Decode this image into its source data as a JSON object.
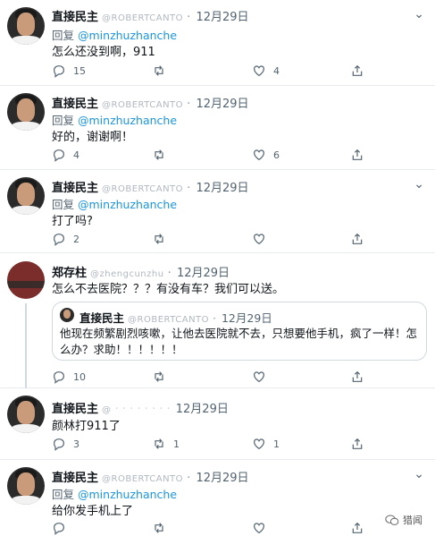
{
  "tweets": [
    {
      "name": "直接民主",
      "handle": "@ROBERTCANTO",
      "date": "12月29日",
      "reply_prefix": "回复",
      "reply_to": "@minzhuzhanche",
      "text": "怎么还没到啊，911",
      "replies": "15",
      "retweets": "",
      "likes": "4"
    },
    {
      "name": "直接民主",
      "handle": "@ROBERTCANTO",
      "date": "12月29日",
      "reply_prefix": "回复",
      "reply_to": "@minzhuzhanche",
      "text": "好的，谢谢啊！",
      "replies": "4",
      "retweets": "",
      "likes": "6"
    },
    {
      "name": "直接民主",
      "handle": "@ROBERTCANTO",
      "date": "12月29日",
      "text": "打了吗?",
      "replies": "2",
      "retweets": "",
      "likes": ""
    },
    {
      "name": "郑存柱",
      "handle": "@zhengcunzhu",
      "date": "12月29日",
      "text": "怎么不去医院？？？有没有车？我们可以送。",
      "quote": {
        "name": "直接民主",
        "handle": "@ROBERTCANTO",
        "date": "12月29日",
        "text": "他现在频繁剧烈咳嗽，让他去医院就不去，只想要他手机，疯了一样！怎么办？求助！！！！！！"
      },
      "replies": "10",
      "retweets": "",
      "likes": ""
    },
    {
      "name": "直接民主",
      "handle": "@",
      "date": "12月29日",
      "text": "颜林打911了",
      "replies": "3",
      "retweets": "1",
      "likes": "1"
    },
    {
      "name": "直接民主",
      "handle": "@ROBERTCANTO",
      "date": "12月29日",
      "reply_prefix": "回复",
      "reply_to": "@minzhuzhanche",
      "text": "给你发手机上了",
      "replies": "",
      "retweets": "",
      "likes": ""
    }
  ],
  "watermark": "猎闻",
  "icons": {
    "reply": "reply-icon",
    "retweet": "retweet-icon",
    "like": "heart-icon",
    "share": "share-icon",
    "more": "chevron-down-icon"
  },
  "colors": {
    "mention": "#1b95e0",
    "muted": "#536471",
    "border": "#e6ecf0"
  }
}
